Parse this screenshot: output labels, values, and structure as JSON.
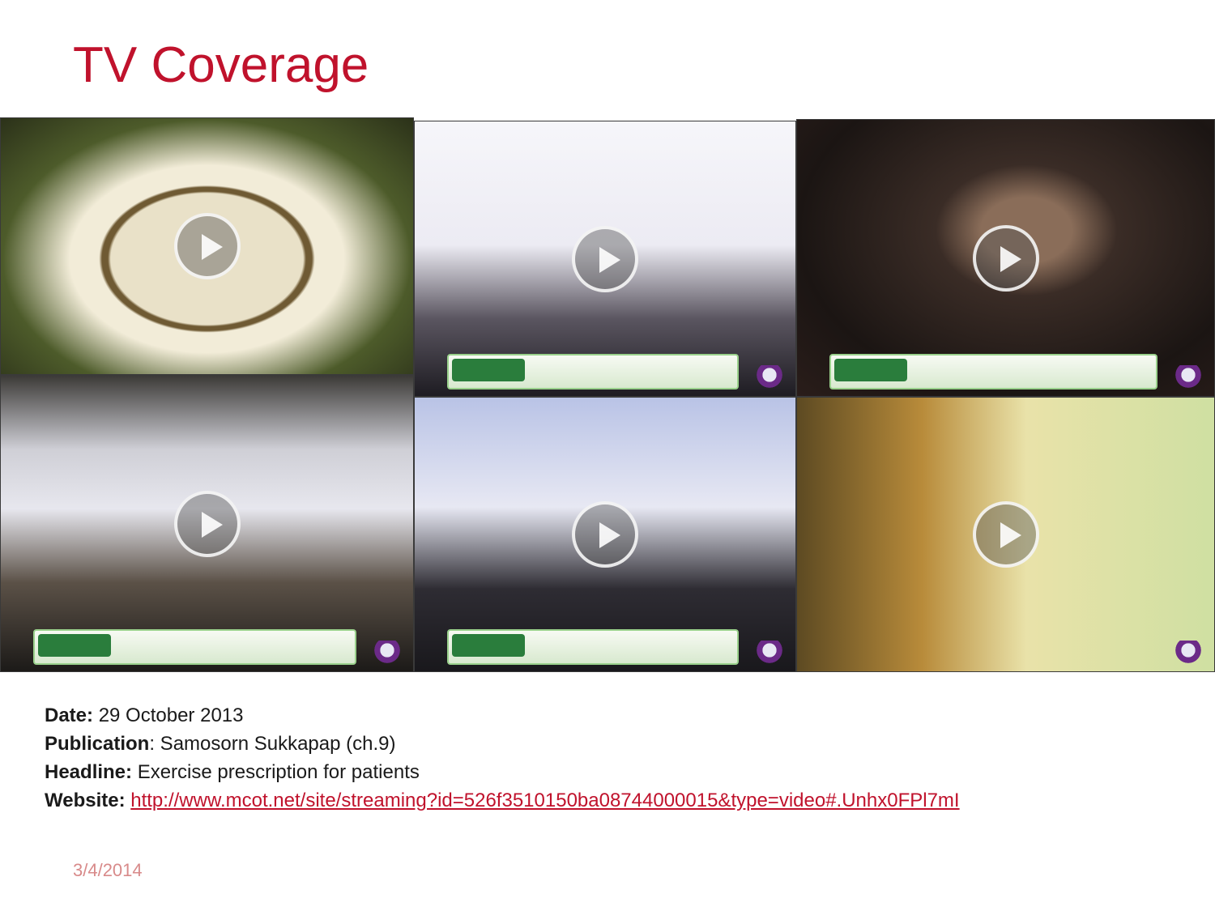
{
  "slide": {
    "title": "TV Coverage",
    "footer_date": "3/4/2014"
  },
  "videos": [
    {
      "name": "video-1"
    },
    {
      "name": "video-2"
    },
    {
      "name": "video-3"
    },
    {
      "name": "video-4"
    },
    {
      "name": "video-5"
    },
    {
      "name": "video-6"
    }
  ],
  "details": {
    "date_label": "Date:",
    "date_value": "29 October 2013",
    "publication_label": "Publication",
    "publication_value": ": Samosorn Sukkapap (ch.9)",
    "headline_label": "Headline:",
    "headline_value": "Exercise prescription for patients",
    "website_label": "Website:",
    "website_url": "http://www.mcot.net/site/streaming?id=526f3510150ba08744000015&type=video#.Unhx0FPl7mI"
  },
  "colors": {
    "title": "#c0122c",
    "link": "#c0122c",
    "footer_date": "#d88a8a"
  },
  "icons": [
    "play-icon"
  ]
}
